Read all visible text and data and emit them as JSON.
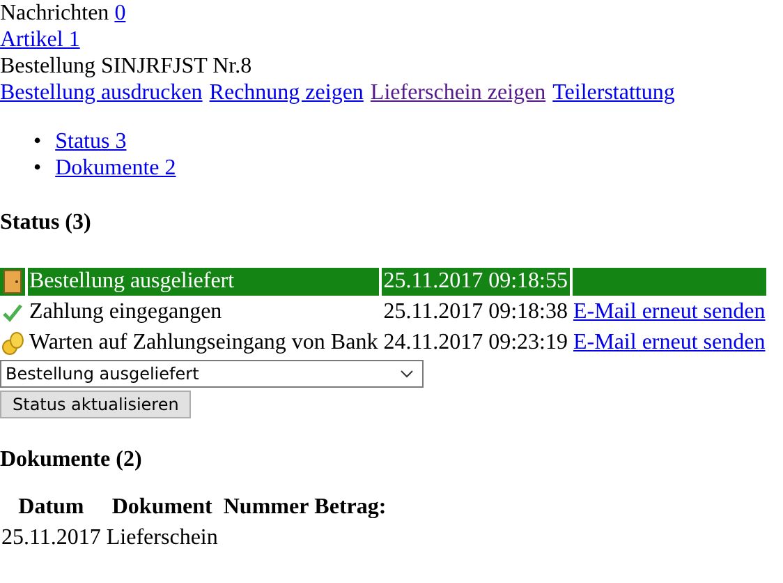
{
  "messages": {
    "label": "Nachrichten",
    "count": "0"
  },
  "article_link": "Artikel 1",
  "order_title": "Bestellung SINJRFJST Nr.8",
  "actions": [
    {
      "label": "Bestellung ausdrucken",
      "visited": false
    },
    {
      "label": "Rechnung zeigen",
      "visited": false
    },
    {
      "label": "Lieferschein zeigen",
      "visited": true
    },
    {
      "label": "Teilerstattung",
      "visited": false
    }
  ],
  "sections_nav": [
    {
      "marker": "•",
      "label": "Status 3"
    },
    {
      "marker": "•",
      "label": "Dokumente 2"
    }
  ],
  "status": {
    "heading": "Status (3)",
    "rows": [
      {
        "kind": "delivered",
        "label": "Bestellung ausgeliefert",
        "time": "25.11.2017 09:18:55",
        "selected": true
      },
      {
        "kind": "paid",
        "label": "Zahlung eingegangen",
        "time": "25.11.2017 09:18:38",
        "action": "E-Mail erneut senden",
        "selected": false
      },
      {
        "kind": "waiting",
        "label": "Warten auf Zahlungseingang von Bank",
        "time": "24.11.2017 09:23:19",
        "action": "E-Mail erneut senden",
        "selected": false
      }
    ],
    "select_value": "Bestellung ausgeliefert",
    "update_button": "Status aktualisieren"
  },
  "documents": {
    "heading": "Dokumente (2)",
    "columns": [
      "Datum",
      "Dokument",
      "Nummer",
      "Betrag:"
    ],
    "rows": [
      [
        "25.11.2017",
        "Lieferschein"
      ]
    ]
  }
}
